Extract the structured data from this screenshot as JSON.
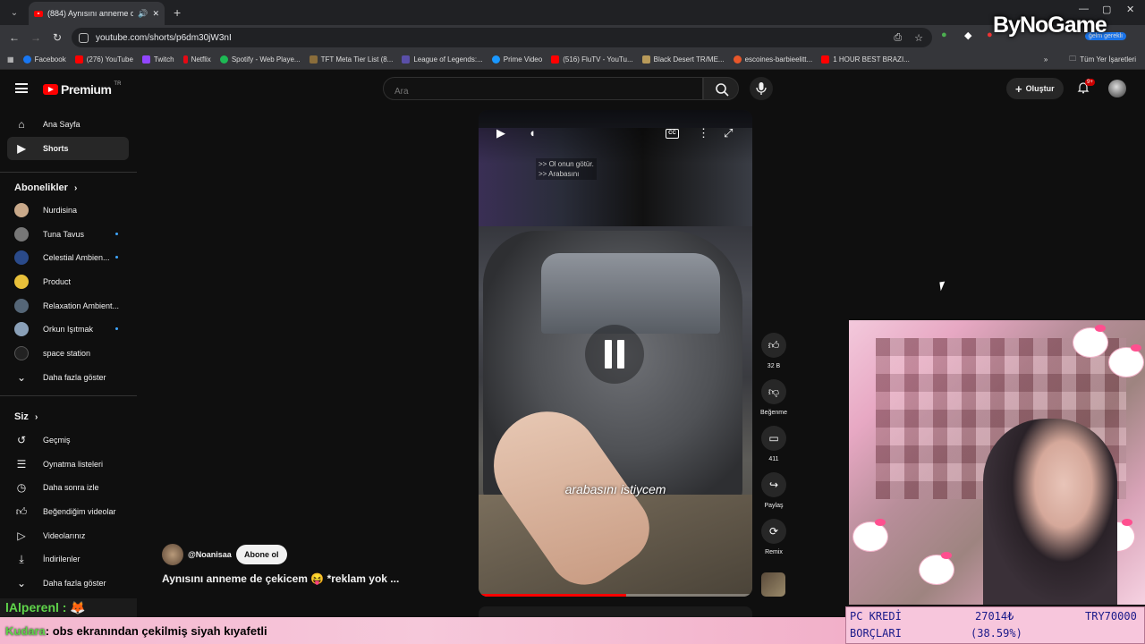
{
  "browser": {
    "tab_title": "(884) Aynısını anneme de ç",
    "url": "youtube.com/shorts/p6dm30jW3nI",
    "profile_label": "ğelm gereklı",
    "bookmarks": [
      "Facebook",
      "(276) YouTube",
      "Twitch",
      "Netflix",
      "Spotify - Web Playe...",
      "TFT Meta Tier List (8...",
      "League of Legends:...",
      "Prime Video",
      "(516) FluTV - YouTu...",
      "Black Desert TR/ME...",
      "escoines-barbieelitt...",
      "1 HOUR BEST BRAZI..."
    ],
    "all_bookmarks_label": "Tüm Yer İşaretleri"
  },
  "overlay_logo": "ByNoGame",
  "youtube": {
    "logo_text": "Premium",
    "logo_region": "TR",
    "search_placeholder": "Ara",
    "create_label": "Oluştur",
    "notif_badge": "9+",
    "sidebar": {
      "main": [
        {
          "label": "Ana Sayfa",
          "icon": "home-icon"
        },
        {
          "label": "Shorts",
          "icon": "shorts-icon"
        }
      ],
      "subs_header": "Abonelikler",
      "subs": [
        {
          "label": "Nurdisina",
          "dot": false,
          "color": "#c9a98a"
        },
        {
          "label": "Tuna Tavus",
          "dot": true,
          "color": "#777"
        },
        {
          "label": "Celestial Ambien...",
          "dot": true,
          "color": "#2a4a8a"
        },
        {
          "label": "Product",
          "dot": false,
          "color": "#e8c03a"
        },
        {
          "label": "Relaxation Ambient...",
          "dot": false,
          "color": "#556677"
        },
        {
          "label": "Orkun Işıtmak",
          "dot": true,
          "color": "#8aa0b8"
        },
        {
          "label": "space station",
          "dot": false,
          "color": "#222"
        }
      ],
      "subs_more": "Daha fazla göster",
      "you_header": "Siz",
      "you": [
        {
          "label": "Geçmiş",
          "icon": "history-icon"
        },
        {
          "label": "Oynatma listeleri",
          "icon": "playlist-icon"
        },
        {
          "label": "Daha sonra izle",
          "icon": "clock-icon"
        },
        {
          "label": "Beğendiğim videolar",
          "icon": "like-icon"
        },
        {
          "label": "Videolarınız",
          "icon": "video-icon"
        },
        {
          "label": "İndirilenler",
          "icon": "download-icon"
        }
      ],
      "you_more": "Daha fazla göster"
    },
    "short": {
      "caption_lines": [
        ">> Ol onun götür.",
        ">> Arabasını"
      ],
      "subtitle": "arabasını istiycem",
      "progress": 0.54,
      "channel": "@Noanisaa",
      "subscribe_label": "Abone ol",
      "title": "Aynısını anneme de çekicem 😝 *reklam yok ...",
      "likes": "32 B",
      "dislike_label": "Beğenme",
      "comments": "411",
      "share_label": "Paylaş",
      "remix_label": "Remix"
    }
  },
  "stream": {
    "top_chat_user": "lAlperenl :",
    "chat_user": "Kudara",
    "chat_message": ": obs ekranından çekilmiş siyah kıyafetli",
    "stats": {
      "label_line1": "PC KREDİ",
      "label_line2": "BORÇLARI",
      "amount": "27014₺",
      "percent": "(38.59%)",
      "target": "TRY70000"
    }
  }
}
